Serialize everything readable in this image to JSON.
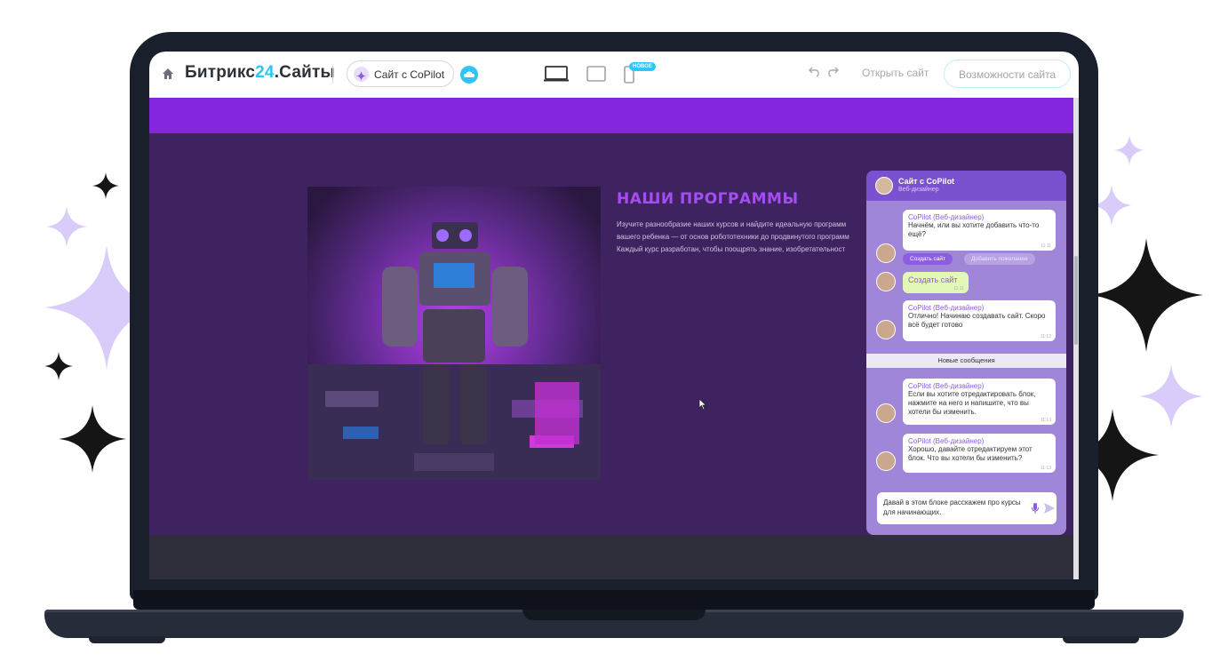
{
  "toolbar": {
    "brand_prefix": "Битрикс",
    "brand_number": "24",
    "brand_suffix": ".Сайты",
    "copilot_button": "Сайт с CoPilot",
    "new_badge": "НОВОЕ",
    "open_site": "Открыть сайт",
    "site_features": "Возможности сайта"
  },
  "section": {
    "title": "НАШИ ПРОГРАММЫ",
    "text_lines": [
      "Изучите разнообразие наших курсов и найдите идеальную программ",
      "вашего ребенка — от основ робототехники до продвинутого программ",
      "Каждый курс разработан, чтобы поощрять знание, изобретательност"
    ]
  },
  "chat": {
    "header_name": "Сайт с CoPilot",
    "header_role": "Веб-дизайнер",
    "messages": [
      {
        "from": "CoPilot (Веб-дизайнер)",
        "text": "Начнём, или вы хотите добавить что-то ещё?",
        "time": "11:11"
      },
      {
        "text": "Создать сайт",
        "time": "11:11"
      },
      {
        "from": "CoPilot (Веб-дизайнер)",
        "text": "Отлично! Начинаю создавать сайт. Скоро всё будет готово",
        "time": "11:12"
      },
      {
        "from": "CoPilot (Веб-дизайнер)",
        "text": "Если вы хотите отредактировать блок, нажмите на него и напишите, что вы хотели бы изменить.",
        "time": "11:13"
      },
      {
        "from": "CoPilot (Веб-дизайнер)",
        "text": "Хорошо, давайте отредактируем этот блок. Что вы хотели бы изменить?",
        "time": "11:13"
      }
    ],
    "actions": {
      "primary": "Создать сайт",
      "secondary": "Добавить пожелания"
    },
    "new_messages_label": "Новые сообщения",
    "input_value": "Давай в этом блоке расскажем про курсы для начинающих."
  },
  "colors": {
    "accent_blue": "#2fc6f6",
    "site_purple": "#8326e0",
    "section_bg": "#3f2360",
    "copilot_purple": "#8b5de3"
  }
}
